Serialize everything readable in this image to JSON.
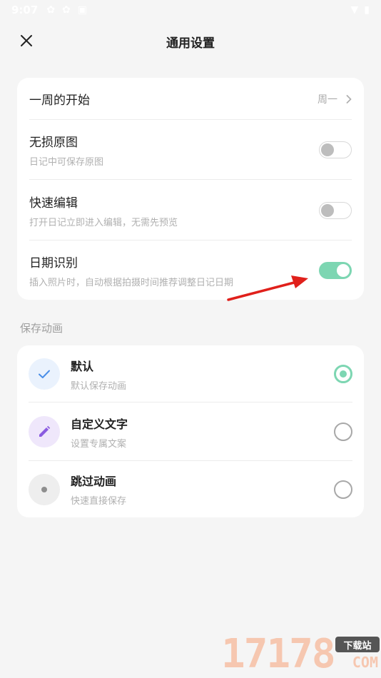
{
  "status_bar": {
    "time": "9:07"
  },
  "header": {
    "title": "通用设置"
  },
  "settings": [
    {
      "title": "一周的开始",
      "value": "周一"
    },
    {
      "title": "无损原图",
      "subtitle": "日记中可保存原图",
      "enabled": false
    },
    {
      "title": "快速编辑",
      "subtitle": "打开日记立即进入编辑，无需先预览",
      "enabled": false
    },
    {
      "title": "日期识别",
      "subtitle": "插入照片时，自动根据拍摄时间推荐调整日记日期",
      "enabled": true
    }
  ],
  "save_animation": {
    "label": "保存动画",
    "options": [
      {
        "title": "默认",
        "subtitle": "默认保存动画",
        "selected": true,
        "icon": "check-icon",
        "icon_bg": "#eaf2fd",
        "icon_color": "#4a8ee8"
      },
      {
        "title": "自定义文字",
        "subtitle": "设置专属文案",
        "selected": false,
        "icon": "pencil-icon",
        "icon_bg": "#efe7fb",
        "icon_color": "#8a5be0"
      },
      {
        "title": "跳过动画",
        "subtitle": "快速直接保存",
        "selected": false,
        "icon": "dot-icon",
        "icon_bg": "#eeeeee",
        "icon_color": "#8e8e8e"
      }
    ]
  },
  "watermark": {
    "digits": "17178",
    "tag": "下载站",
    "domain": "COM"
  },
  "colors": {
    "accent": "#7dd6b2",
    "annotation_arrow": "#e0201b"
  }
}
